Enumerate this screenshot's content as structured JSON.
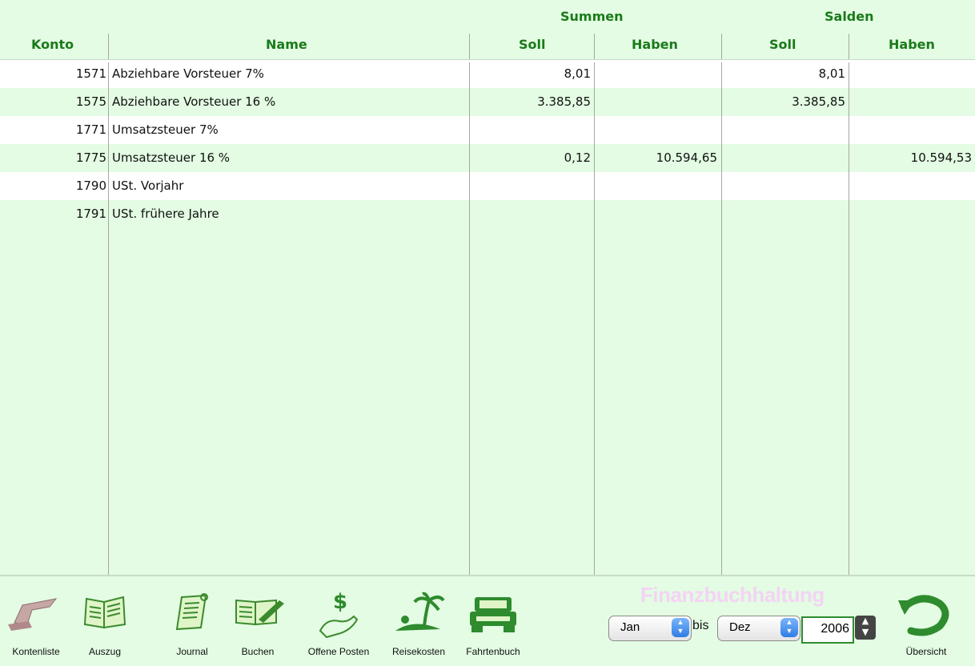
{
  "header": {
    "summen": "Summen",
    "salden": "Salden",
    "columns": {
      "konto": "Konto",
      "name": "Name",
      "summen_soll": "Soll",
      "summen_haben": "Haben",
      "salden_soll": "Soll",
      "salden_haben": "Haben"
    }
  },
  "rows": [
    {
      "konto": "1571",
      "name": "Abziehbare Vorsteuer 7%",
      "summen_soll": "8,01",
      "summen_haben": "",
      "salden_soll": "8,01",
      "salden_haben": ""
    },
    {
      "konto": "1575",
      "name": "Abziehbare Vorsteuer 16 %",
      "summen_soll": "3.385,85",
      "summen_haben": "",
      "salden_soll": "3.385,85",
      "salden_haben": ""
    },
    {
      "konto": "1771",
      "name": "Umsatzsteuer 7%",
      "summen_soll": "",
      "summen_haben": "",
      "salden_soll": "",
      "salden_haben": ""
    },
    {
      "konto": "1775",
      "name": "Umsatzsteuer 16 %",
      "summen_soll": "0,12",
      "summen_haben": "10.594,65",
      "salden_soll": "",
      "salden_haben": "10.594,53"
    },
    {
      "konto": "1790",
      "name": "USt. Vorjahr",
      "summen_soll": "",
      "summen_haben": "",
      "salden_soll": "",
      "salden_haben": ""
    },
    {
      "konto": "1791",
      "name": "USt. frühere Jahre",
      "summen_soll": "",
      "summen_haben": "",
      "salden_soll": "",
      "salden_haben": ""
    }
  ],
  "toolbar": {
    "kontenliste": "Kontenliste",
    "auszug": "Auszug",
    "journal": "Journal",
    "buchen": "Buchen",
    "offene_posten": "Offene Posten",
    "reisekosten": "Reisekosten",
    "fahrtenbuch": "Fahrtenbuch",
    "uebersicht": "Übersicht"
  },
  "app_title": "Finanzbuchhaltung",
  "period": {
    "from_month": "Jan",
    "bis_label": "bis",
    "to_month": "Dez",
    "year": "2006"
  },
  "colors": {
    "background": "#e3fce3",
    "header_text": "#1a7a1a",
    "white_row": "#ffffff",
    "title_watermark": "#f5d3f5"
  },
  "icons": {
    "kontenliste": "hand-card-icon",
    "auszug": "open-book-icon",
    "journal": "scroll-icon",
    "buchen": "pen-book-icon",
    "offene_posten": "hand-dollar-icon",
    "reisekosten": "palm-island-icon",
    "fahrtenbuch": "car-icon",
    "uebersicht": "return-arrow-icon"
  }
}
